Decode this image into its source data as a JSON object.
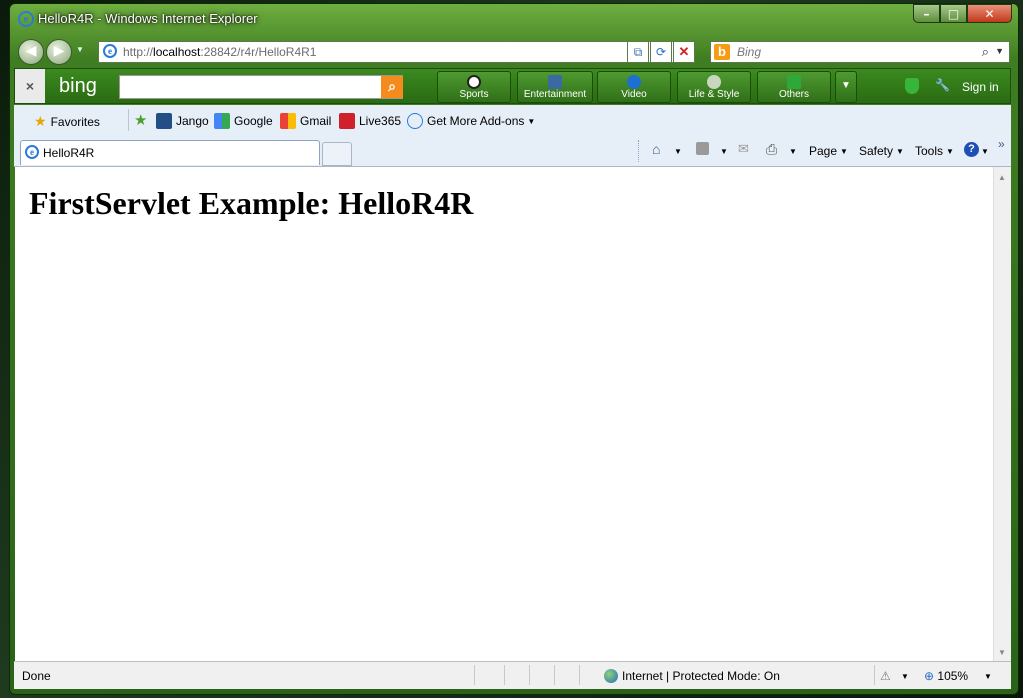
{
  "window": {
    "title": "HelloR4R - Windows Internet Explorer"
  },
  "caption_buttons": {
    "minimize": "–",
    "maximize": "□",
    "close": "✕"
  },
  "nav": {
    "back": "◀",
    "forward": "▶",
    "address_prefix": "http://",
    "address_host": "localhost",
    "address_rest": ":28842/r4r/HelloR4R1",
    "search_placeholder": "Bing"
  },
  "bing_bar": {
    "close": "×",
    "logo": "bing",
    "tabs": [
      {
        "label": "Sports",
        "icon": "soccer-ball-icon"
      },
      {
        "label": "Entertainment",
        "icon": "entertainment-icon"
      },
      {
        "label": "Video",
        "icon": "video-play-icon"
      },
      {
        "label": "Life & Style",
        "icon": "cup-icon"
      },
      {
        "label": "Others",
        "icon": "others-icon"
      }
    ],
    "sign_in": "Sign in"
  },
  "favorites_bar": {
    "favorites": "Favorites",
    "items": [
      "Jango",
      "Google",
      "Gmail",
      "Live365",
      "Get More Add-ons"
    ]
  },
  "tab": {
    "label": "HelloR4R"
  },
  "command_bar": {
    "page": "Page",
    "safety": "Safety",
    "tools": "Tools"
  },
  "content": {
    "heading": "FirstServlet Example: HelloR4R"
  },
  "status_bar": {
    "status": "Done",
    "zone": "Internet | Protected Mode: On",
    "zoom": "105%"
  },
  "colors": {
    "frame": "#2a6318",
    "bing_orange": "#f58a1f",
    "toolbar_bg": "#e6eef8"
  }
}
